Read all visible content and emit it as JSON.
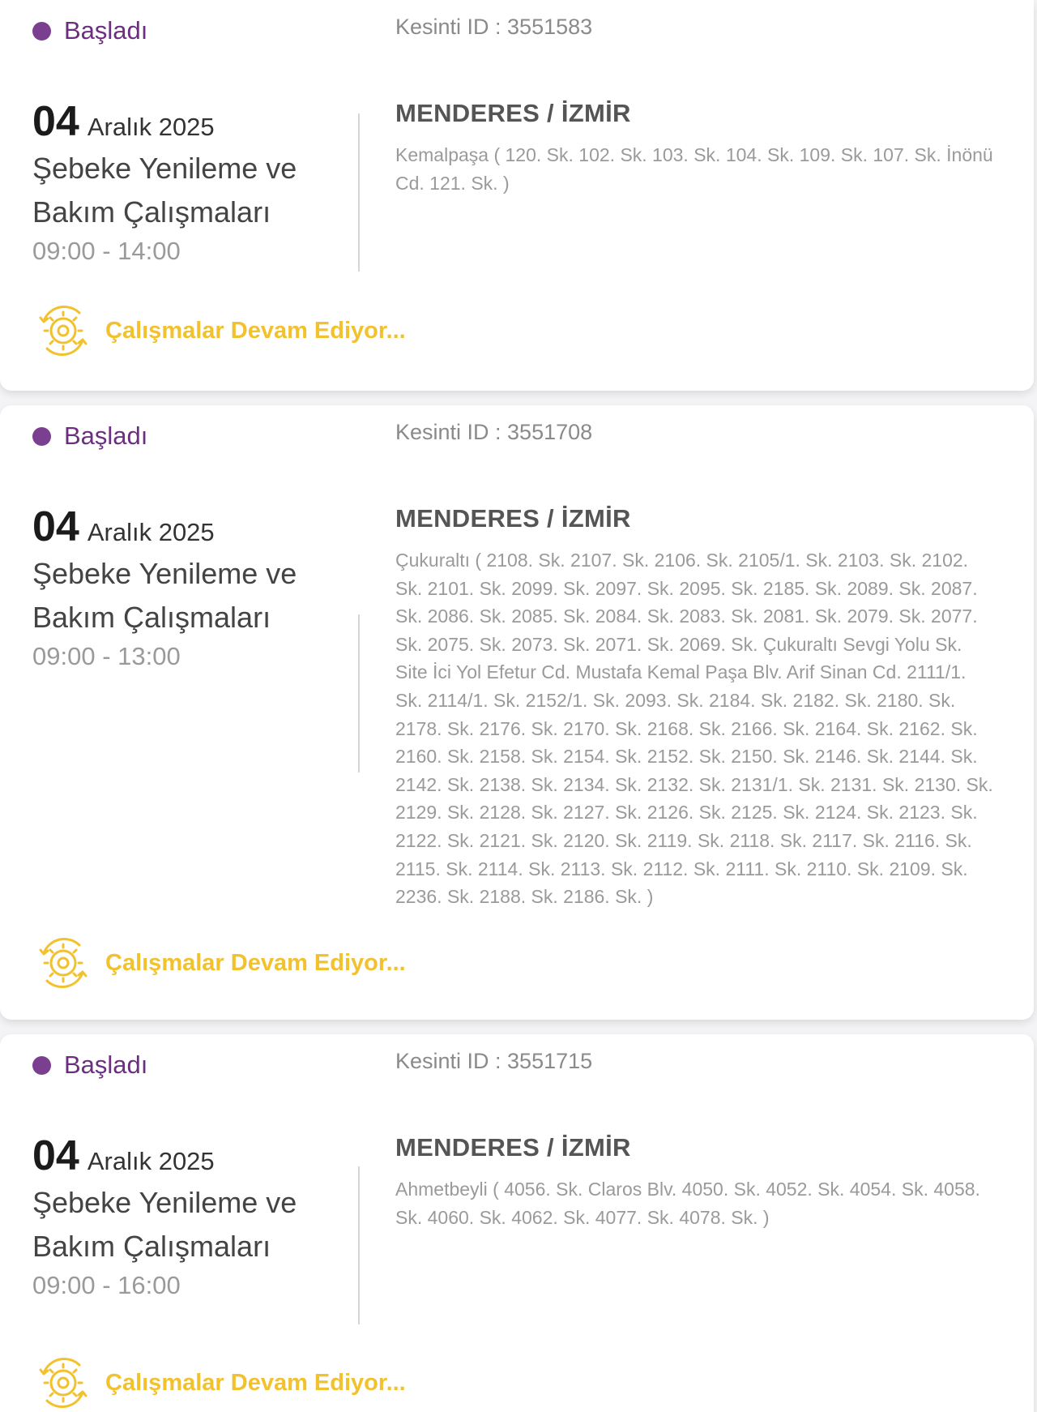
{
  "outages": [
    {
      "status": "Başladı",
      "kesinti_label": "Kesinti ID : 3551583",
      "day": "04",
      "month_year": "Aralık 2025",
      "title_line1": "Şebeke Yenileme ve",
      "title_line2": "Bakım Çalışmaları",
      "time": "09:00 - 14:00",
      "region": "MENDERES / İZMİR",
      "streets": "Kemalpaşa ( 120. Sk. 102. Sk. 103. Sk. 104. Sk. 109. Sk. 107. Sk. İnönü Cd. 121. Sk. )",
      "progress": "Çalışmalar Devam Ediyor..."
    },
    {
      "status": "Başladı",
      "kesinti_label": "Kesinti ID : 3551708",
      "day": "04",
      "month_year": "Aralık 2025",
      "title_line1": "Şebeke Yenileme ve",
      "title_line2": "Bakım Çalışmaları",
      "time": "09:00 - 13:00",
      "region": "MENDERES / İZMİR",
      "streets": "Çukuraltı ( 2108. Sk. 2107. Sk. 2106. Sk. 2105/1. Sk. 2103. Sk. 2102. Sk. 2101. Sk. 2099. Sk. 2097. Sk. 2095. Sk. 2185. Sk. 2089. Sk. 2087. Sk. 2086. Sk. 2085. Sk. 2084. Sk. 2083. Sk. 2081. Sk. 2079. Sk. 2077. Sk. 2075. Sk. 2073. Sk. 2071. Sk. 2069. Sk. Çukuraltı Sevgi Yolu Sk. Site İci Yol Efetur Cd. Mustafa Kemal Paşa Blv. Arif Sinan Cd. 2111/1. Sk. 2114/1. Sk. 2152/1. Sk. 2093. Sk. 2184. Sk. 2182. Sk. 2180. Sk. 2178. Sk. 2176. Sk. 2170. Sk. 2168. Sk. 2166. Sk. 2164. Sk. 2162. Sk. 2160. Sk. 2158. Sk. 2154. Sk. 2152. Sk. 2150. Sk. 2146. Sk. 2144. Sk. 2142. Sk. 2138. Sk. 2134. Sk. 2132. Sk. 2131/1. Sk. 2131. Sk. 2130. Sk. 2129. Sk. 2128. Sk. 2127. Sk. 2126. Sk. 2125. Sk. 2124. Sk. 2123. Sk. 2122. Sk. 2121. Sk. 2120. Sk. 2119. Sk. 2118. Sk. 2117. Sk. 2116. Sk. 2115. Sk. 2114. Sk. 2113. Sk. 2112. Sk. 2111. Sk. 2110. Sk. 2109. Sk. 2236. Sk. 2188. Sk. 2186. Sk. )",
      "progress": "Çalışmalar Devam Ediyor..."
    },
    {
      "status": "Başladı",
      "kesinti_label": "Kesinti ID : 3551715",
      "day": "04",
      "month_year": "Aralık 2025",
      "title_line1": "Şebeke Yenileme ve",
      "title_line2": "Bakım Çalışmaları",
      "time": "09:00 - 16:00",
      "region": "MENDERES / İZMİR",
      "streets": "Ahmetbeyli ( 4056. Sk. Claros Blv. 4050. Sk. 4052. Sk. 4054. Sk. 4058. Sk. 4060. Sk. 4062. Sk. 4077. Sk. 4078. Sk. )",
      "progress": "Çalışmalar Devam Ediyor..."
    }
  ],
  "colors": {
    "status_dot": "#7a3f8f",
    "status_text": "#6c2f80",
    "progress": "#f2c12e"
  },
  "icons": {
    "status": "status-dot-icon",
    "progress": "gear-refresh-icon"
  }
}
